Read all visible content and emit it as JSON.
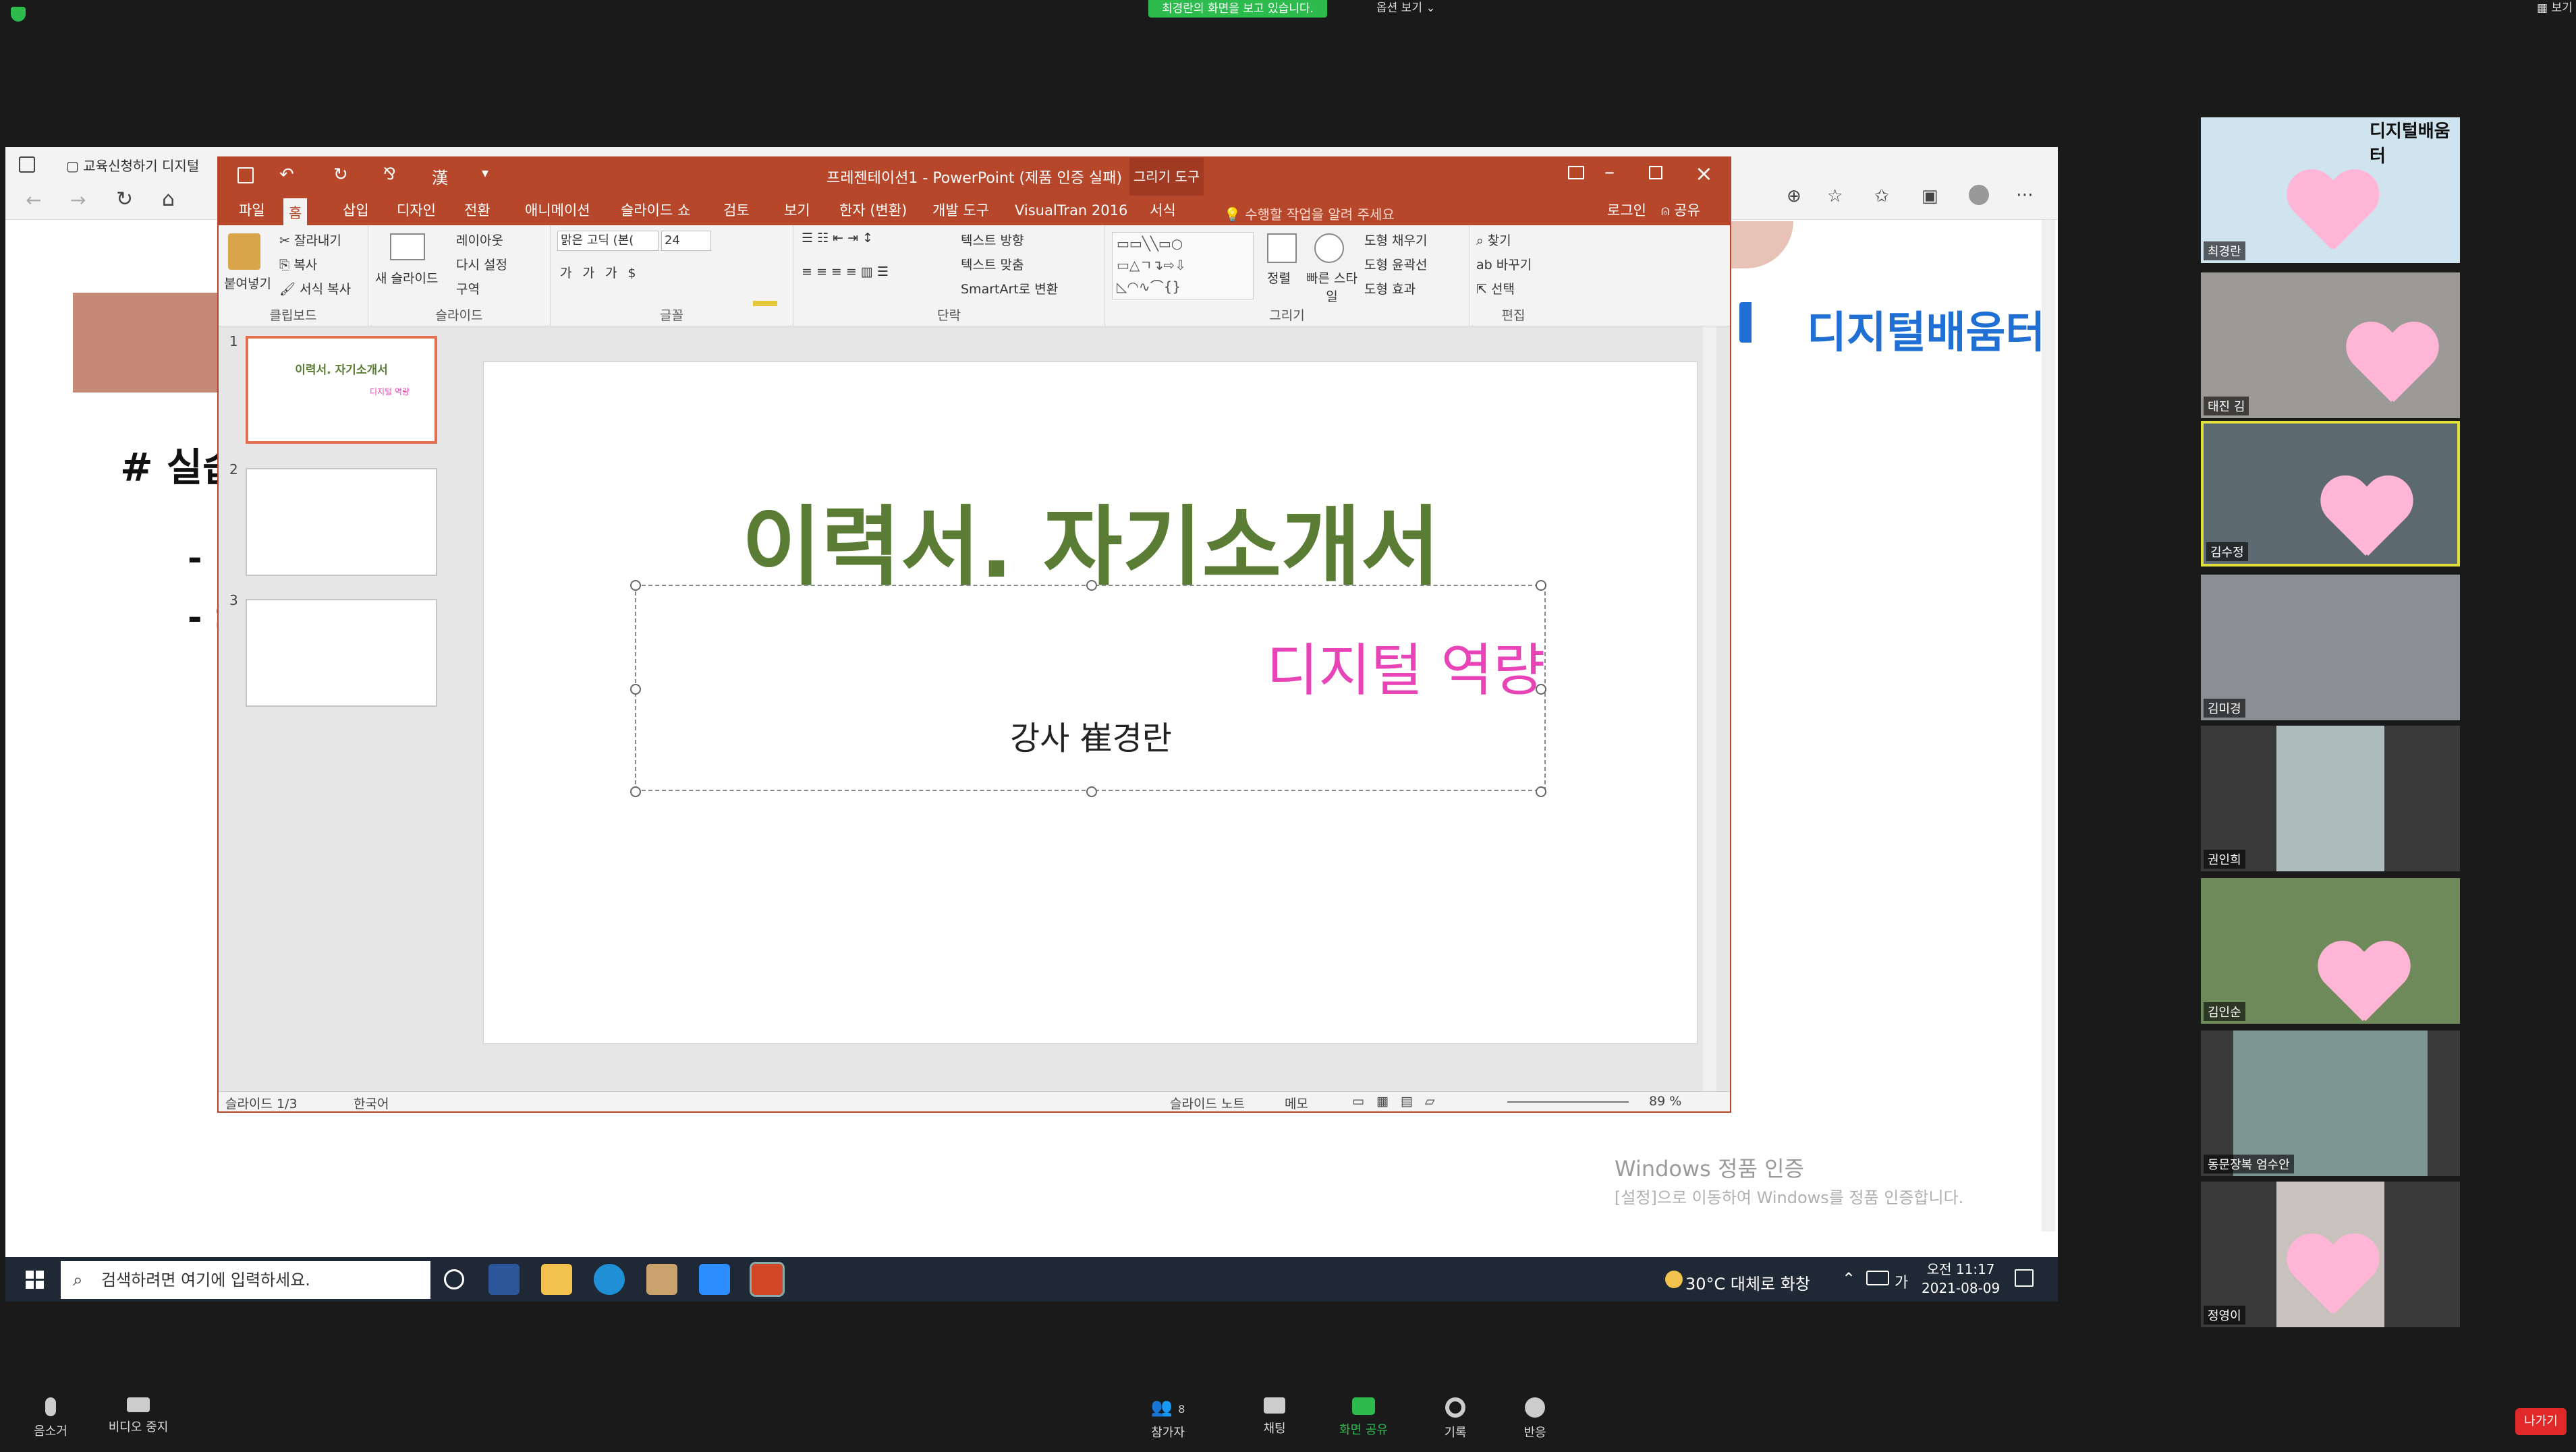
{
  "zoom": {
    "share_banner": "최경란의 화면을 보고 있습니다.",
    "view_options": "옵션 보기 ⌄",
    "gallery_view": "보기",
    "toolbar": {
      "mute": "음소거",
      "stop_video": "비디오 중지",
      "participants": "참가자",
      "participants_count": "8",
      "chat": "채팅",
      "share_screen": "화면 공유",
      "record": "기록",
      "reactions": "반응",
      "leave": "나가기"
    }
  },
  "participants": [
    {
      "name": "최경란",
      "active": false
    },
    {
      "name": "태진 김",
      "active": false
    },
    {
      "name": "김수정",
      "active": true
    },
    {
      "name": "김미경",
      "active": false
    },
    {
      "name": "권인희",
      "active": false
    },
    {
      "name": "김인순",
      "active": false
    },
    {
      "name": "동문장복 엄수안",
      "active": false
    },
    {
      "name": "정영이",
      "active": false
    }
  ],
  "browser": {
    "tab_title": "교육신청하기 디지털"
  },
  "pdf": {
    "logo": "디지털배움터",
    "logo_top": "디지털배움터",
    "heading": "# 실습",
    "bullet1": "- ",
    "bullet2": "- S",
    "windows_activation": "Windows 정품 인증",
    "windows_activation_sub": "[설정]으로 이동하여 Windows를 정품 인증합니다."
  },
  "taskbar": {
    "search_placeholder": "검색하려면 여기에 입력하세요.",
    "weather": "30°C  대체로 화창",
    "ime": "가",
    "time": "오전 11:17",
    "date": "2021-08-09"
  },
  "powerpoint": {
    "window_title": "프레젠테이션1 - PowerPoint (제품 인증 실패)",
    "draw_tools": "그리기 도구",
    "tabs": [
      "파일",
      "홈",
      "삽입",
      "디자인",
      "전환",
      "애니메이션",
      "슬라이드 쇼",
      "검토",
      "보기",
      "한자 (변환)",
      "개발 도구",
      "VisualTran 2016",
      "서식"
    ],
    "tell_me": "수행할 작업을 알려 주세요",
    "login": "로그인",
    "share": "공유",
    "ribbon": {
      "clipboard": "클립보드",
      "paste": "붙여넣기",
      "cut": "잘라내기",
      "copy": "복사",
      "format_painter": "서식 복사",
      "slides": "슬라이드",
      "new_slide": "새 슬라이드",
      "layout": "레이아웃",
      "reset": "다시 설정",
      "section": "구역",
      "font": "글꼴",
      "font_name": "맑은 고딕 (본(",
      "font_size": "24",
      "paragraph": "단락",
      "text_direction": "텍스트 방향",
      "align_text": "텍스트 맞춤",
      "smartart": "SmartArt로 변환",
      "drawing": "그리기",
      "arrange": "정렬",
      "quick_styles": "빠른 스타일",
      "shape_fill": "도형 채우기",
      "shape_outline": "도형 윤곽선",
      "shape_effects": "도형 효과",
      "editing": "편집",
      "find": "찾기",
      "replace": "바꾸기",
      "select": "선택"
    },
    "thumbnails": [
      {
        "num": "1",
        "title": "이력서. 자기소개서",
        "sub": "디지털 역량"
      },
      {
        "num": "2"
      },
      {
        "num": "3"
      }
    ],
    "slide": {
      "title": "이력서. 자기소개서",
      "subtitle": "디지털 역량",
      "lecturer": "강사 崔경란"
    },
    "status": {
      "slide_count": "슬라이드 1/3",
      "language": "한국어",
      "notes": "슬라이드 노트",
      "comments": "메모",
      "zoom": "89 %"
    }
  }
}
